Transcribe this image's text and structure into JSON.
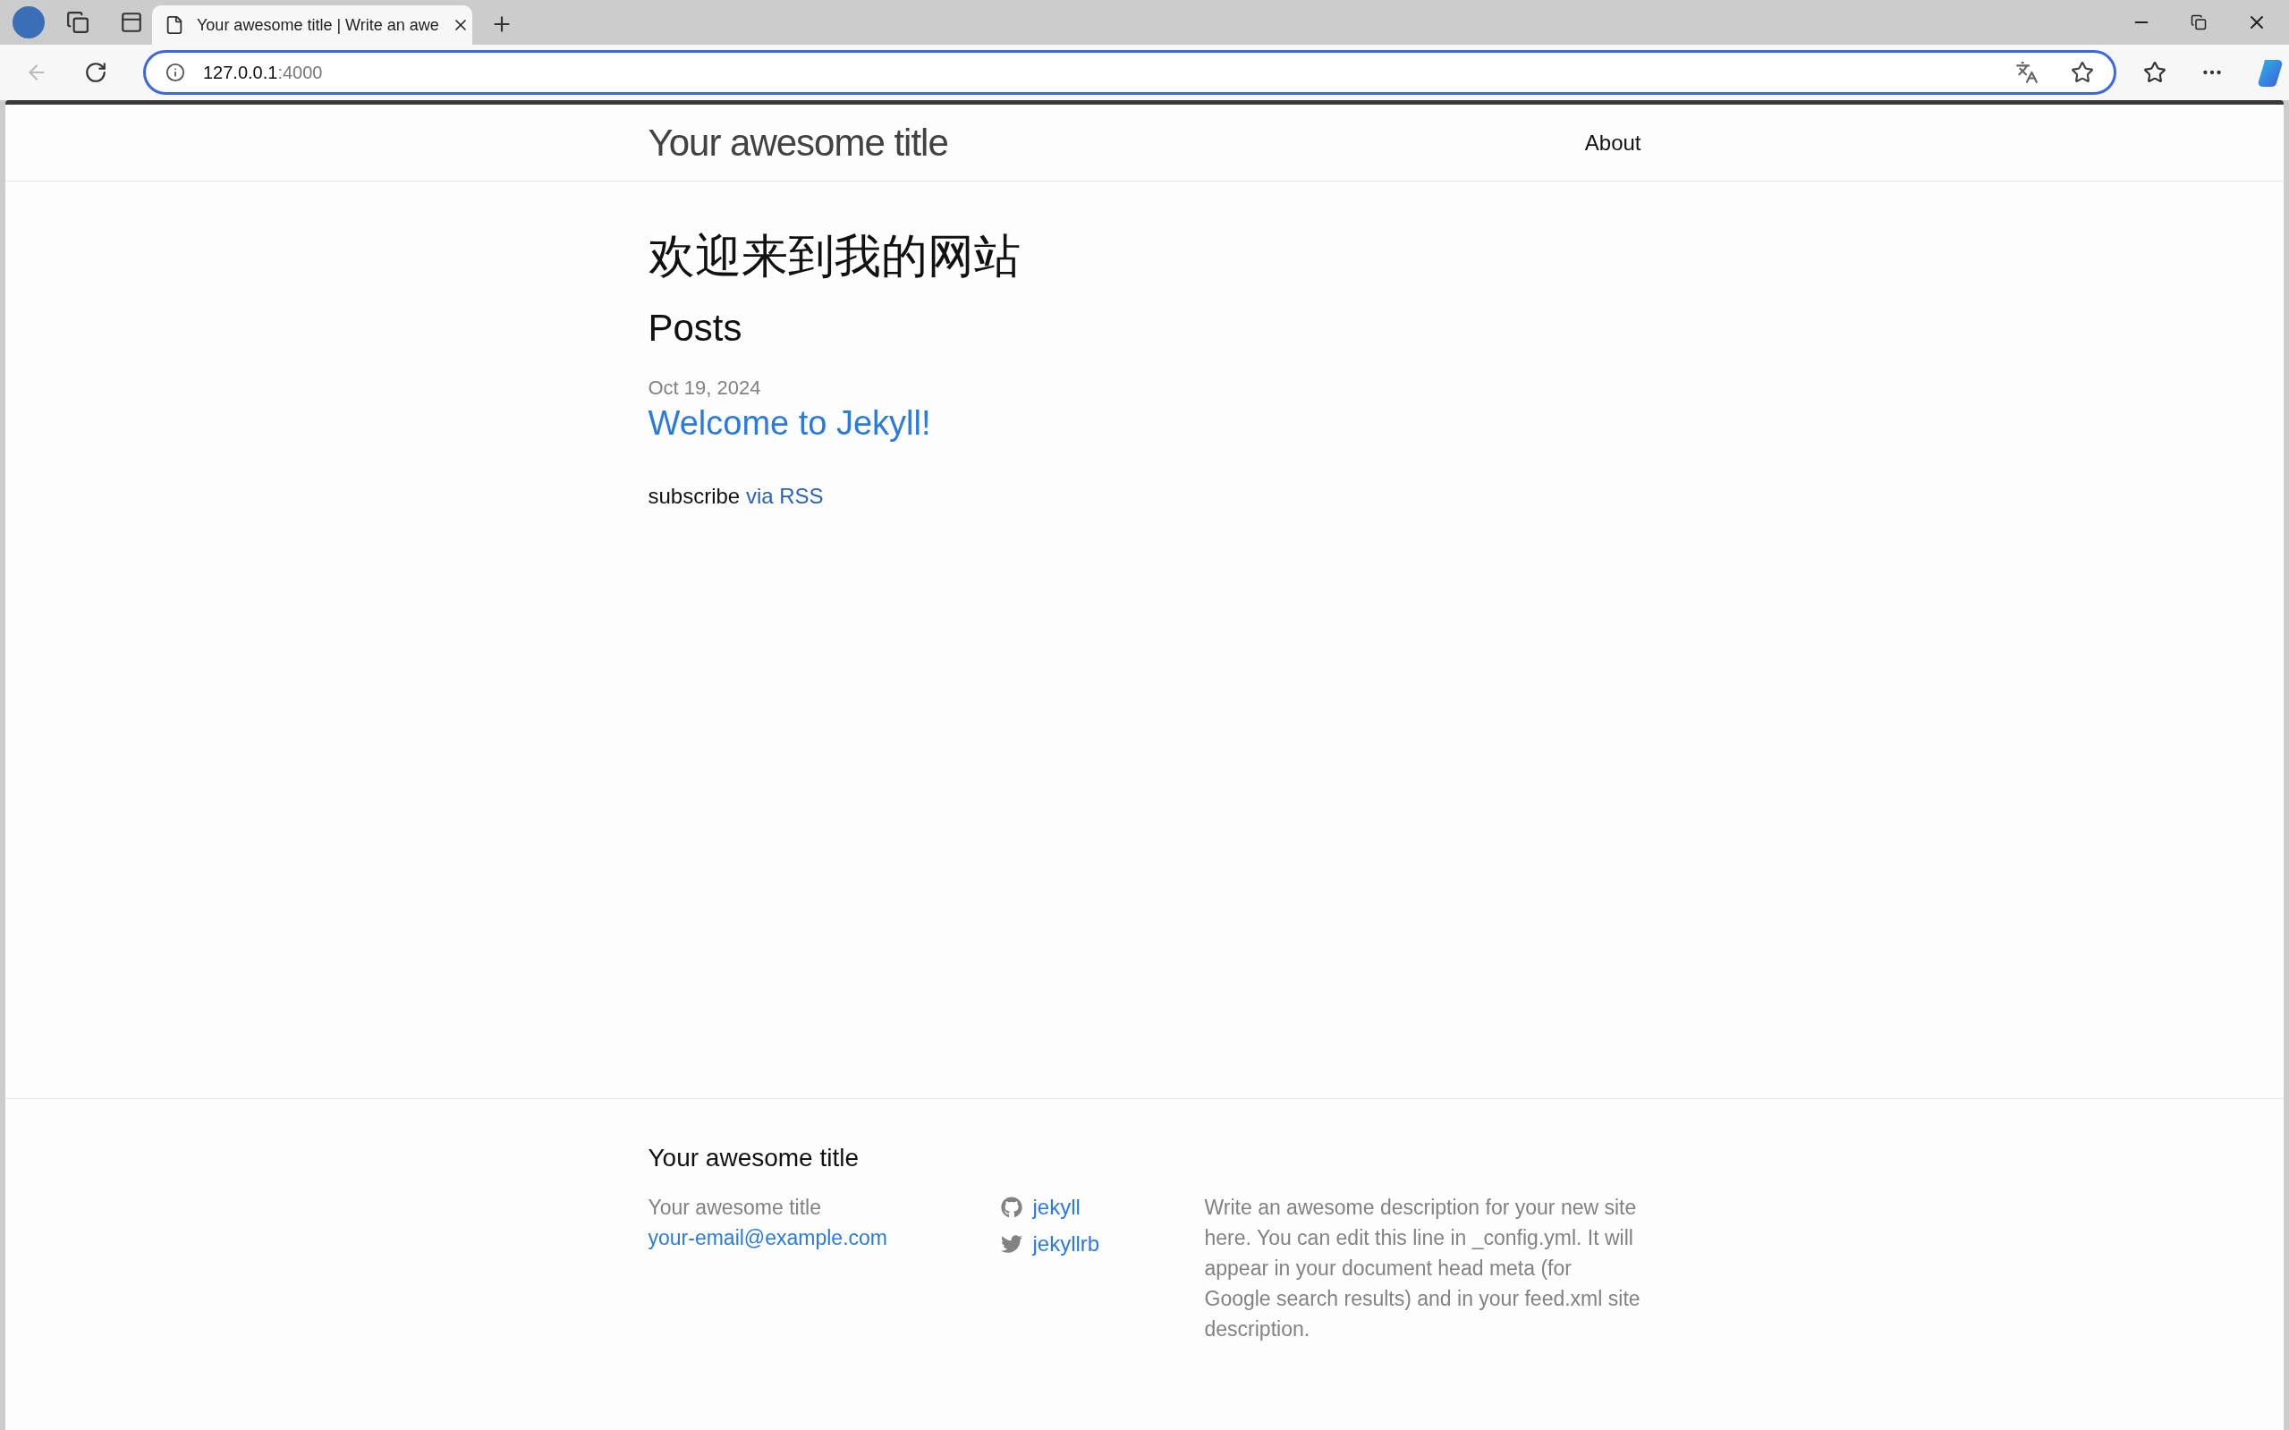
{
  "browser": {
    "tabs": [
      {
        "title": "Your awesome title | Write an awe",
        "selected": true
      }
    ],
    "address": {
      "host": "127.0.0.1",
      "port": ":4000"
    }
  },
  "page": {
    "header": {
      "site_title": "Your awesome title",
      "nav": [
        {
          "label": "About"
        }
      ]
    },
    "heading": "欢迎来到我的网站",
    "posts_heading": "Posts",
    "posts": [
      {
        "date": "Oct 19, 2024",
        "title": "Welcome to Jekyll!"
      }
    ],
    "subscribe": {
      "text": "subscribe",
      "link": "via RSS"
    },
    "footer": {
      "title": "Your awesome title",
      "contact": {
        "name": "Your awesome title",
        "email": "your-email@example.com"
      },
      "social": [
        {
          "kind": "github",
          "label": "jekyll"
        },
        {
          "kind": "twitter",
          "label": "jekyllrb"
        }
      ],
      "description": "Write an awesome description for your new site here. You can edit this line in _config.yml. It will appear in your document head meta (for Google search results) and in your feed.xml site description."
    }
  }
}
